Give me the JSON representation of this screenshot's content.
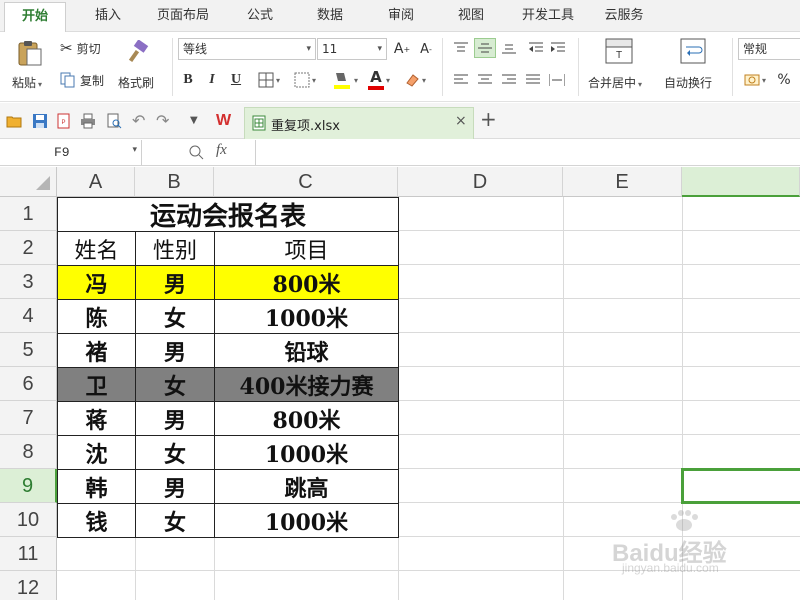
{
  "menu": {
    "tabs": [
      "开始",
      "插入",
      "页面布局",
      "公式",
      "数据",
      "审阅",
      "视图",
      "开发工具",
      "云服务"
    ]
  },
  "ribbon": {
    "paste": "粘贴",
    "cut": "剪切",
    "copy": "复制",
    "format_painter": "格式刷",
    "font_name": "等线",
    "font_size": "11",
    "bold": "B",
    "italic": "I",
    "underline": "U",
    "font_color_glyph": "A",
    "merge_center": "合并居中",
    "wrap_text": "自动换行",
    "number_format": "常规",
    "percent": "%",
    "increase_font": "A",
    "decrease_font": "A"
  },
  "document": {
    "tab_name": "重复项.xlsx"
  },
  "formula_bar": {
    "name_box": "F9",
    "fx": "fx",
    "formula": ""
  },
  "columns": [
    "A",
    "B",
    "C",
    "D",
    "E"
  ],
  "rows": [
    "1",
    "2",
    "3",
    "4",
    "5",
    "6",
    "7",
    "8",
    "9",
    "10",
    "11",
    "12"
  ],
  "sheet": {
    "title": "运动会报名表",
    "headers": [
      "姓名",
      "性别",
      "项目"
    ],
    "data": [
      [
        "冯",
        "男",
        "800米"
      ],
      [
        "陈",
        "女",
        "1000米"
      ],
      [
        "褚",
        "男",
        "铅球"
      ],
      [
        "卫",
        "女",
        "400米接力赛"
      ],
      [
        "蒋",
        "男",
        "800米"
      ],
      [
        "沈",
        "女",
        "1000米"
      ],
      [
        "韩",
        "男",
        "跳高"
      ],
      [
        "钱",
        "女",
        "1000米"
      ]
    ]
  },
  "colors": {
    "accent_green": "#2e7d32",
    "selection_green": "#4aa03a",
    "highlight_yellow": "#ffff00",
    "highlight_gray": "#808080"
  },
  "watermark": {
    "brand": "Baidu经验",
    "url": "jingyan.baidu.com"
  }
}
